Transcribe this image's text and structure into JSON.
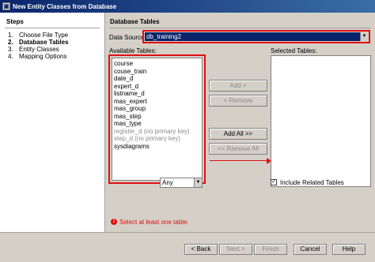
{
  "window": {
    "title": "New Entity Classes from Database"
  },
  "steps": {
    "title": "Steps",
    "items": [
      {
        "num": "1.",
        "label": "Choose File Type"
      },
      {
        "num": "2.",
        "label": "Database Tables"
      },
      {
        "num": "3.",
        "label": "Entity Classes"
      },
      {
        "num": "4.",
        "label": "Mapping Options"
      }
    ],
    "current_index": 1
  },
  "main": {
    "title": "Database Tables",
    "data_source": {
      "label": "Data Source:",
      "value": "db_training2"
    },
    "available": {
      "label": "Available Tables:",
      "items": [
        {
          "label": "course",
          "disabled": false
        },
        {
          "label": "couse_train",
          "disabled": false
        },
        {
          "label": "date_d",
          "disabled": false
        },
        {
          "label": "expert_d",
          "disabled": false
        },
        {
          "label": "listname_d",
          "disabled": false
        },
        {
          "label": "mas_expert",
          "disabled": false
        },
        {
          "label": "mas_group",
          "disabled": false
        },
        {
          "label": "mas_step",
          "disabled": false
        },
        {
          "label": "mas_type",
          "disabled": false
        },
        {
          "label": "register_d (no primary key)",
          "disabled": true
        },
        {
          "label": "step_d (no primary key)",
          "disabled": true
        },
        {
          "label": "sysdiagrams",
          "disabled": false
        }
      ]
    },
    "selected": {
      "label": "Selected Tables:"
    },
    "buttons": {
      "add": "Add >",
      "remove": "< Remove",
      "add_all": "Add All >>",
      "remove_all": "<< Remove All"
    },
    "filter": {
      "value": "Any"
    },
    "include_related": {
      "label": "Include Related Tables",
      "checked": true
    },
    "error": {
      "message": "Select at least one table."
    }
  },
  "footer": {
    "back": "< Back",
    "next": "Next >",
    "finish": "Finish",
    "cancel": "Cancel",
    "help": "Help"
  },
  "colors": {
    "highlight": "#e01010",
    "selection": "#0a246a",
    "titlebar": "#0a246a"
  }
}
